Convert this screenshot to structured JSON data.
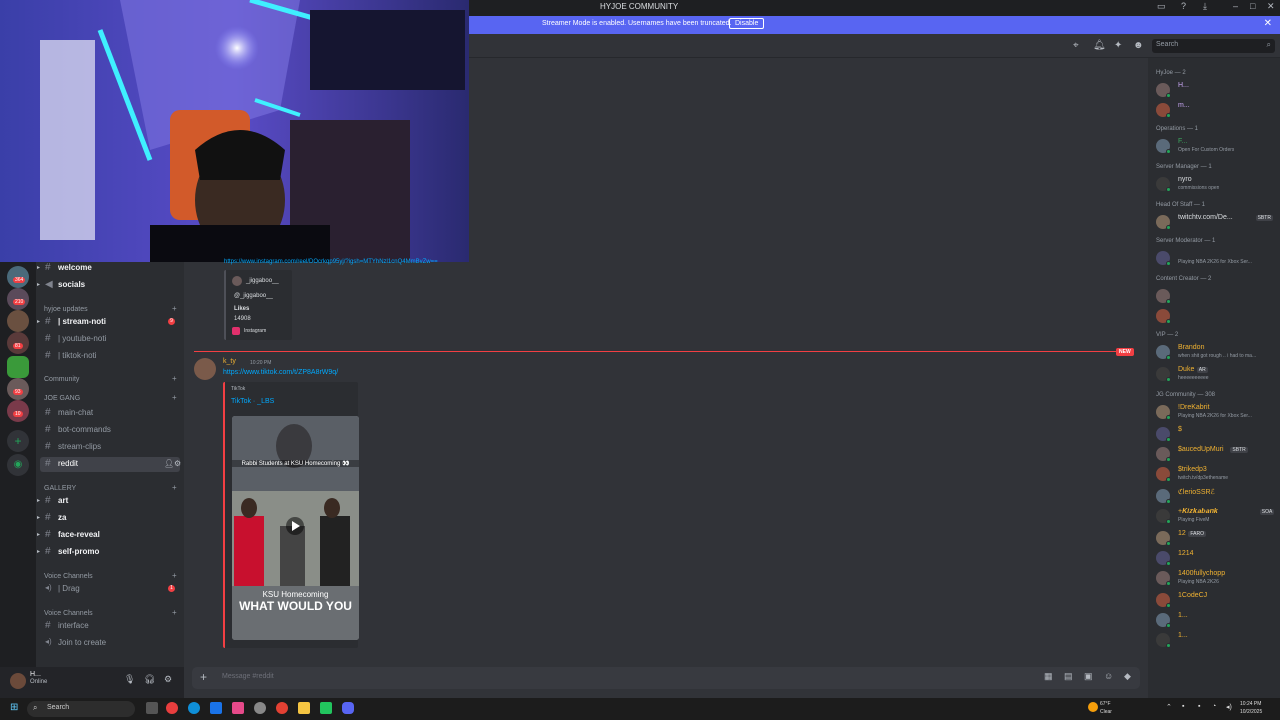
{
  "titlebar": {
    "title": "HYJOE COMMUNITY"
  },
  "banner": {
    "text": "Streamer Mode is enabled. Usernames have been truncated.",
    "button": "Disable"
  },
  "toolbar": {
    "search_placeholder": "Search"
  },
  "guild_badges": [
    "364",
    "210",
    "81",
    "93",
    "10"
  ],
  "channels": {
    "top": [
      {
        "name": "welcome",
        "bold": true,
        "icon": "hash"
      },
      {
        "name": "socials",
        "bold": true,
        "icon": "megaphone"
      }
    ],
    "categories": {
      "hyjoe_updates": "hyjoe updates",
      "community": "Community",
      "joe_gang": "JOE GANG",
      "gallery": "GALLERY",
      "voice1": "Voice Channels",
      "voice2": "Voice Channels"
    },
    "hyjoe_updates": [
      {
        "name": "| stream-noti",
        "bold": true,
        "badge": "9"
      },
      {
        "name": "| youtube-noti"
      },
      {
        "name": "| tiktok-noti"
      }
    ],
    "joe_gang": [
      {
        "name": "main-chat"
      },
      {
        "name": "bot-commands"
      },
      {
        "name": "stream-clips"
      },
      {
        "name": "reddit",
        "selected": true
      }
    ],
    "gallery": [
      {
        "name": "art",
        "bold": true
      },
      {
        "name": "za",
        "bold": true
      },
      {
        "name": "face-reveal",
        "bold": true
      },
      {
        "name": "self-promo",
        "bold": true
      }
    ],
    "voice1": [
      {
        "name": "| Drag",
        "badge": "1"
      }
    ],
    "voice2": [
      {
        "name": "interface"
      },
      {
        "name": "Join to create"
      }
    ]
  },
  "user": {
    "name": "H...",
    "status": "Online"
  },
  "chat": {
    "prev_link": "https://www.instagram.com/reel/DOcrkqp95yj/?igsh=MTYhNzl1cnQ4MmBvZw==",
    "embed1": {
      "user": "_jiggaboo__",
      "handle": "@_jiggaboo__",
      "likes_label": "Likes",
      "likes": "14908",
      "provider": "Instagram"
    },
    "new_tag": "NEW",
    "author": "k_ty",
    "time": "10:20 PM",
    "link": "https://www.tiktok.com/t/ZP8A8rW9q/",
    "embed2": {
      "provider": "TikTok",
      "title": "TikTok · _LBS",
      "caption_top": "Rabbi Students at KSU Homecoming 👀",
      "caption_mid": "KSU Homecoming",
      "caption_bottom": "WHAT WOULD YOU"
    },
    "composer_placeholder": "Message #reddit"
  },
  "members": {
    "groups": [
      {
        "label": "HyJoe — 2",
        "items": [
          {
            "name": "H...",
            "color": "#c9a7f5"
          },
          {
            "name": "m...",
            "color": "#c9a7f5"
          }
        ]
      },
      {
        "label": "Operations — 1",
        "items": [
          {
            "name": "F...",
            "color": "#3ba55c",
            "sub": "Open For Custom Orders"
          }
        ]
      },
      {
        "label": "Server Manager — 1",
        "items": [
          {
            "name": "nyro",
            "color": "#dbdee1",
            "sub": "commissions open"
          }
        ]
      },
      {
        "label": "Head Of Staff — 1",
        "items": [
          {
            "name": "twitchtv.com/De...",
            "color": "#dbdee1",
            "tag": "SBTR"
          }
        ]
      },
      {
        "label": "Server Moderator — 1",
        "items": [
          {
            "name": "",
            "color": "#dbdee1",
            "sub": "Playing NBA 2K26 for Xbox Ser..."
          }
        ]
      },
      {
        "label": "Content Creator — 2",
        "items": [
          {
            "name": "",
            "color": "#dbdee1"
          },
          {
            "name": "",
            "color": "#dbdee1"
          }
        ]
      },
      {
        "label": "VIP — 2",
        "items": [
          {
            "name": "Brandon",
            "color": "#f0b232",
            "sub": "when shit got rough .. i had to ma..."
          },
          {
            "name": "Duke",
            "color": "#f0b232",
            "tag": "AR",
            "sub": "heeeeeeeeee"
          }
        ]
      },
      {
        "label": "JG Community — 308",
        "items": [
          {
            "name": "!DreKabrit",
            "color": "#f0b232",
            "sub": "Playing NBA 2K26 for Xbox Ser..."
          },
          {
            "name": "$",
            "color": "#f0b232"
          },
          {
            "name": "$aucedUpMuri",
            "color": "#f0b232",
            "tag": "SBTR"
          },
          {
            "name": "$trikedp3",
            "color": "#f0b232",
            "sub": "twitch.tv/dp3ethename"
          },
          {
            "name": "ℭlerioSSRℰ",
            "color": "#f0b232"
          },
          {
            "name": "+𝑲𝒊𝒛𝒌𝒂𝒃𝒂𝒏𝒌",
            "color": "#f0b232",
            "tag": "SOA",
            "sub": "Playing FiveM"
          },
          {
            "name": "12",
            "color": "#f0b232",
            "tag": "FARO"
          },
          {
            "name": "1214",
            "color": "#f0b232"
          },
          {
            "name": "1400fullychopp",
            "color": "#f0b232",
            "sub": "Playing NBA 2K26"
          },
          {
            "name": "1CodeCJ",
            "color": "#f0b232"
          },
          {
            "name": "1...",
            "color": "#f0b232"
          },
          {
            "name": "1...",
            "color": "#f0b232"
          }
        ]
      }
    ]
  },
  "taskbar": {
    "search": "Search",
    "weather_temp": "67°F",
    "weather_desc": "Clear",
    "time": "10:24 PM",
    "date": "10/2/2025"
  }
}
